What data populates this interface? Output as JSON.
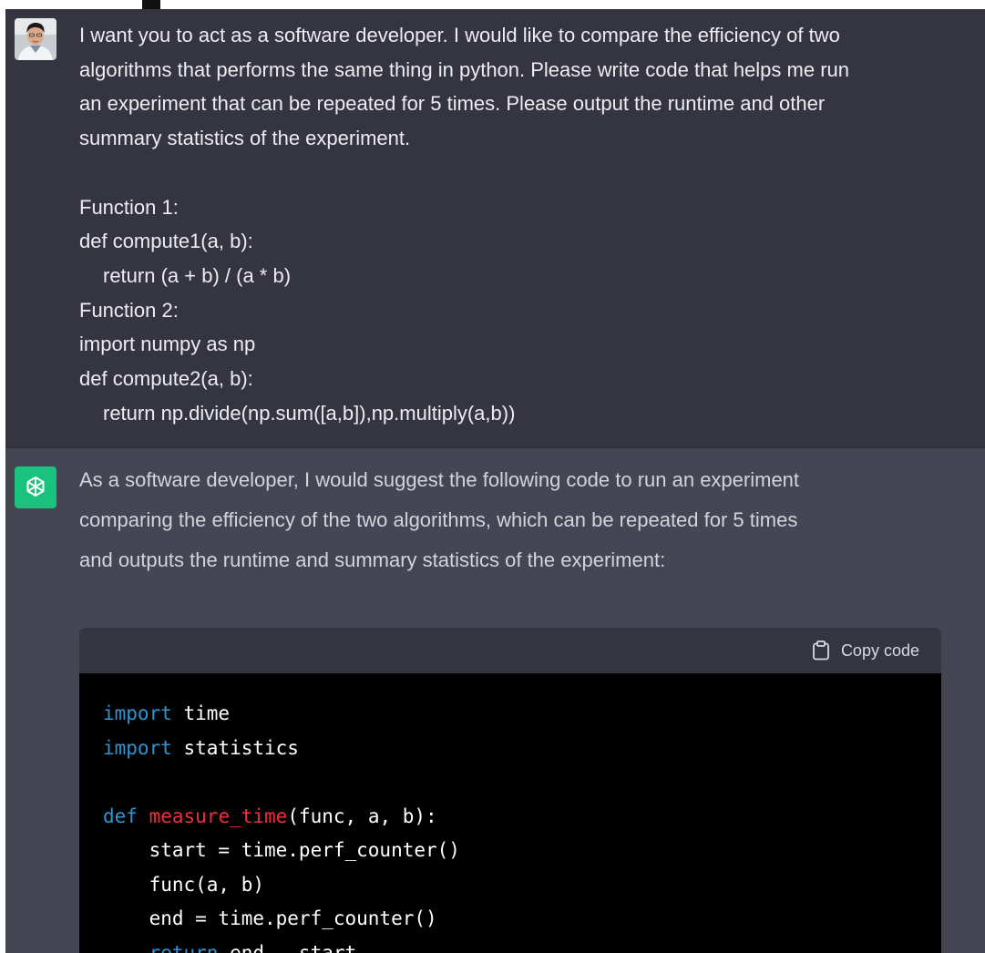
{
  "user_message": {
    "avatar": "user-photo-avatar",
    "paragraph_lines": [
      "I want you to act as a software developer. I would like to compare the efficiency of two",
      "algorithms that performs the same thing in python. Please write code that helps me run",
      "an experiment that can be repeated for 5 times. Please output the runtime and other",
      "summary statistics of the experiment."
    ],
    "function_lines": [
      "Function 1:",
      "def compute1(a, b):",
      "return (a + b) / (a * b)",
      "Function 2:",
      "import numpy as np",
      "def compute2(a, b):",
      "return np.divide(np.sum([a,b]),np.multiply(a,b))"
    ]
  },
  "assistant_message": {
    "avatar": "chatgpt-logo-icon",
    "intro_lines": [
      "As a software developer, I would suggest the following code to run an experiment",
      "comparing the efficiency of the two algorithms, which can be repeated for 5 times",
      "and outputs the runtime and summary statistics of the experiment:"
    ],
    "code_block": {
      "copy_label": "Copy code",
      "copy_icon": "clipboard-icon",
      "tokens": {
        "l1_kw": "import",
        "l1_rest": " time",
        "l2_kw": "import",
        "l2_rest": " statistics",
        "l4_kw": "def",
        "l4_fn": "measure_time",
        "l4_rest": "(func, a, b):",
        "l5": "    start = time.perf_counter()",
        "l6": "    func(a, b)",
        "l7": "    end = time.perf_counter()",
        "l8_kw": "return",
        "l8_rest": " end - start"
      }
    }
  },
  "colors": {
    "user_bg": "#343541",
    "assistant_bg": "#444654",
    "code_bg": "#000000",
    "keyword": "#2e95d3",
    "function_name": "#f22c3d",
    "bot_avatar_bg": "#19c37d"
  }
}
